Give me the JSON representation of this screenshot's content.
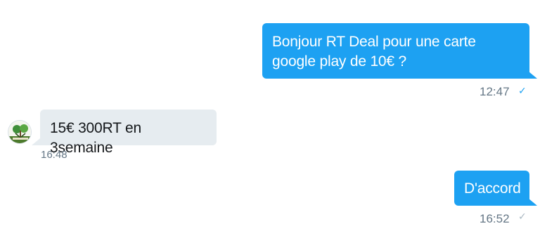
{
  "conversation": {
    "messages": [
      {
        "direction": "outgoing",
        "text": "Bonjour RT Deal pour une carte google play de 10€ ?",
        "time": "12:47",
        "status_icon": "check-read-icon"
      },
      {
        "direction": "incoming",
        "text": "15€ 300RT en 3semaine",
        "time": "16:48",
        "avatar_icon": "tree-logo-avatar"
      },
      {
        "direction": "outgoing",
        "text": "D'accord",
        "time": "16:52",
        "status_icon": "check-sent-icon"
      }
    ]
  },
  "colors": {
    "outgoing_bubble": "#1da1f2",
    "incoming_bubble": "#e6ecf0",
    "timestamp": "#657786",
    "read_check": "#1da1f2",
    "sent_check": "#aab8c2"
  }
}
